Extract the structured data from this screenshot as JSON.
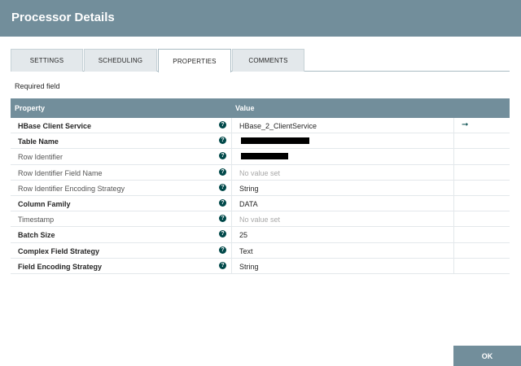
{
  "header": {
    "title": "Processor Details"
  },
  "tabs": [
    {
      "label": "SETTINGS"
    },
    {
      "label": "SCHEDULING"
    },
    {
      "label": "PROPERTIES"
    },
    {
      "label": "COMMENTS"
    }
  ],
  "required_label": "Required field",
  "table": {
    "columns": {
      "property": "Property",
      "value": "Value"
    },
    "rows": [
      {
        "property": "HBase Client Service",
        "value": "HBase_2_ClientService"
      },
      {
        "property": "Table Name",
        "value": ""
      },
      {
        "property": "Row Identifier",
        "value": ""
      },
      {
        "property": "Row Identifier Field Name",
        "value": "No value set"
      },
      {
        "property": "Row Identifier Encoding Strategy",
        "value": "String"
      },
      {
        "property": "Column Family",
        "value": "DATA"
      },
      {
        "property": "Timestamp",
        "value": "No value set"
      },
      {
        "property": "Batch Size",
        "value": "25"
      },
      {
        "property": "Complex Field Strategy",
        "value": "Text"
      },
      {
        "property": "Field Encoding Strategy",
        "value": "String"
      }
    ],
    "help_glyph": "?",
    "goto_glyph": "➞"
  },
  "footer": {
    "ok_label": "OK"
  },
  "colors": {
    "header": "#728e9b",
    "icon": "#004849"
  }
}
